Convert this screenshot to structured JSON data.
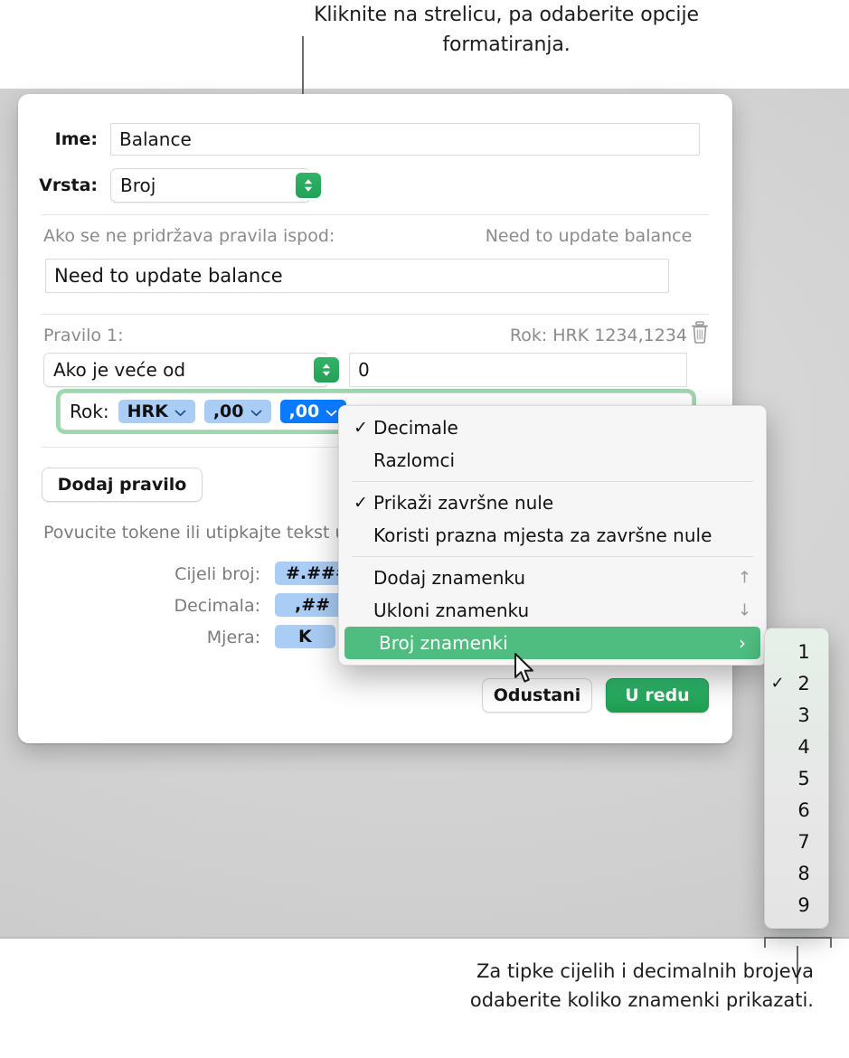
{
  "callouts": {
    "top": "Kliknite na strelicu, pa odaberite opcije formatiranja.",
    "bottom": "Za tipke cijelih i decimalnih brojeva odaberite koliko znamenki prikazati."
  },
  "dialog": {
    "name_label": "Ime:",
    "name_value": "Balance",
    "type_label": "Vrsta:",
    "type_value": "Broj",
    "fallback_label": "Ako se ne pridržava pravila ispod:",
    "fallback_preview": "Need to update balance",
    "fallback_value": "Need to update balance",
    "rule_label": "Pravilo 1:",
    "rule_preview": "Rok: HRK 1234,1234",
    "delete_icon": "trash-icon",
    "condition_value": "Ako je veće od",
    "threshold_value": "0",
    "token_editor": {
      "prefix": "Rok:",
      "tokens": [
        {
          "label": "HRK",
          "selected": false
        },
        {
          "label": ",00",
          "selected": false
        },
        {
          "label": ",00",
          "selected": true
        }
      ]
    },
    "add_rule_label": "Dodaj pravilo",
    "hint": "Povucite tokene ili utipkajte tekst u polja.",
    "legend": [
      {
        "label": "Cijeli broj:",
        "token": "#.###"
      },
      {
        "label": "Decimala:",
        "token": ",##"
      },
      {
        "label": "Mjera:",
        "token": "K"
      }
    ],
    "cancel_label": "Odustani",
    "ok_label": "U redu"
  },
  "menu": {
    "items": [
      {
        "label": "Decimale",
        "checked": true,
        "tail": "",
        "selected": false
      },
      {
        "label": "Razlomci",
        "checked": false,
        "tail": "",
        "selected": false
      },
      {
        "separator": true
      },
      {
        "label": "Prikaži završne nule",
        "checked": true,
        "tail": "",
        "selected": false
      },
      {
        "label": "Koristi prazna mjesta za završne nule",
        "checked": false,
        "tail": "",
        "selected": false
      },
      {
        "separator": true
      },
      {
        "label": "Dodaj znamenku",
        "checked": false,
        "tail": "↑",
        "selected": false
      },
      {
        "label": "Ukloni znamenku",
        "checked": false,
        "tail": "↓",
        "selected": false
      },
      {
        "label": "Broj znamenki",
        "checked": false,
        "tail": "›",
        "selected": true
      }
    ]
  },
  "submenu": {
    "items": [
      {
        "value": "1",
        "checked": false
      },
      {
        "value": "2",
        "checked": true
      },
      {
        "value": "3",
        "checked": false
      },
      {
        "value": "4",
        "checked": false
      },
      {
        "value": "5",
        "checked": false
      },
      {
        "value": "6",
        "checked": false
      },
      {
        "value": "7",
        "checked": false
      },
      {
        "value": "8",
        "checked": false
      },
      {
        "value": "9",
        "checked": false
      }
    ]
  },
  "colors": {
    "accent_green": "#22a157",
    "selection_green": "#4fbd80",
    "token_blue": "#aacdf5",
    "token_blue_selected": "#0a7bff",
    "focus_ring": "#9bd8ae"
  }
}
